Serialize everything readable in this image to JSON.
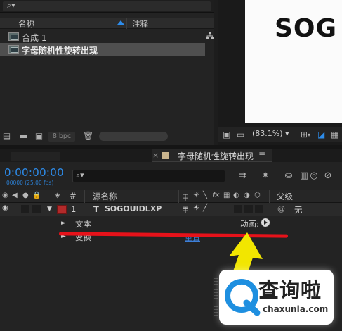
{
  "project_panel": {
    "search_glyph": "⌕▾",
    "columns": {
      "name": "名称",
      "comment": "注释"
    },
    "items": [
      {
        "label": "合成 1",
        "icon": "composition-icon"
      },
      {
        "label": "字母随机性旋转出现",
        "icon": "composition-icon"
      }
    ],
    "footer": {
      "bpc": "8 bpc"
    }
  },
  "viewer": {
    "canvas_text": "SOG",
    "zoom": "(83.1%)",
    "zoom_caret": "▾"
  },
  "timeline": {
    "tab_name": "字母随机性旋转出现",
    "tab_close": "×",
    "tab_menu": "≡",
    "timecode": "0:00:00:00",
    "fps_text": "00000 (25.00 fps)",
    "search_glyph": "⌕▾",
    "columns": {
      "hash": "#",
      "source_name": "源名称",
      "parent": "父级"
    },
    "layer": {
      "number": "1",
      "type_glyph": "T",
      "name": "SOGOUIDLXP",
      "parent": "无",
      "label_color": "#b22a2a"
    },
    "text_group": {
      "label": "文本",
      "animate": "动画:"
    },
    "transform_group": {
      "label": "变换",
      "reset": "重置"
    }
  },
  "annotation": {
    "line_color": "#e6121a",
    "arrow_color": "#f2e600"
  },
  "watermark": {
    "cn": "查询啦",
    "en": "chaxunla.com"
  }
}
